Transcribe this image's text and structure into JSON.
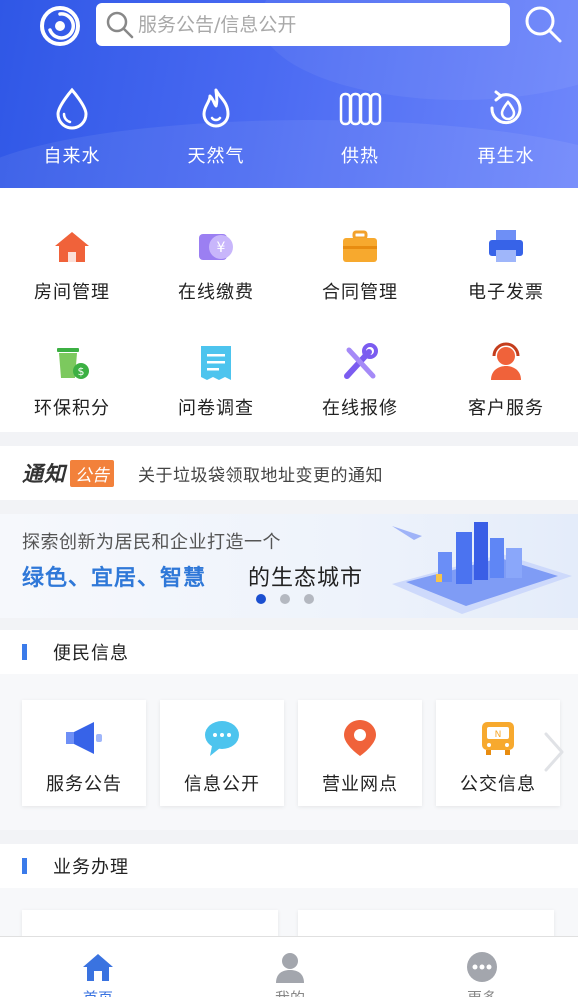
{
  "search": {
    "placeholder": "服务公告/信息公开"
  },
  "utilities": [
    {
      "label": "自来水",
      "icon": "water-drop-icon"
    },
    {
      "label": "天然气",
      "icon": "flame-icon"
    },
    {
      "label": "供热",
      "icon": "radiator-icon"
    },
    {
      "label": "再生水",
      "icon": "recycled-water-icon"
    }
  ],
  "services": [
    {
      "label": "房间管理",
      "icon": "house-icon"
    },
    {
      "label": "在线缴费",
      "icon": "yen-wallet-icon"
    },
    {
      "label": "合同管理",
      "icon": "briefcase-icon"
    },
    {
      "label": "电子发票",
      "icon": "printer-icon"
    },
    {
      "label": "环保积分",
      "icon": "trash-coin-icon"
    },
    {
      "label": "问卷调查",
      "icon": "survey-icon"
    },
    {
      "label": "在线报修",
      "icon": "wrench-screwdriver-icon"
    },
    {
      "label": "客户服务",
      "icon": "headset-agent-icon"
    }
  ],
  "notice": {
    "tag_part1": "通知",
    "tag_part2": "公告",
    "text": "关于垃圾袋领取地址变更的通知"
  },
  "banner": {
    "line1": "探索创新为居民和企业打造一个",
    "highlight": "绿色、宜居、智慧",
    "suffix": "的生态城市",
    "slide_count": 3,
    "active_slide": 1
  },
  "sections": {
    "info_title": "便民信息",
    "business_title": "业务办理"
  },
  "info_cards": [
    {
      "label": "服务公告",
      "icon": "megaphone-icon"
    },
    {
      "label": "信息公开",
      "icon": "chat-bubble-icon"
    },
    {
      "label": "营业网点",
      "icon": "location-pin-icon"
    },
    {
      "label": "公交信息",
      "icon": "bus-icon"
    }
  ],
  "bottom_nav": [
    {
      "label": "首页",
      "icon": "home-icon",
      "active": true
    },
    {
      "label": "我的",
      "icon": "user-icon",
      "active": false
    },
    {
      "label": "更多",
      "icon": "more-icon",
      "active": false
    }
  ],
  "colors": {
    "header_start": "#2f57e6",
    "header_end": "#6f87fb",
    "accent_blue": "#3b7bea",
    "notice_orange": "#f2813b",
    "active_dot": "#1b4fd0"
  }
}
